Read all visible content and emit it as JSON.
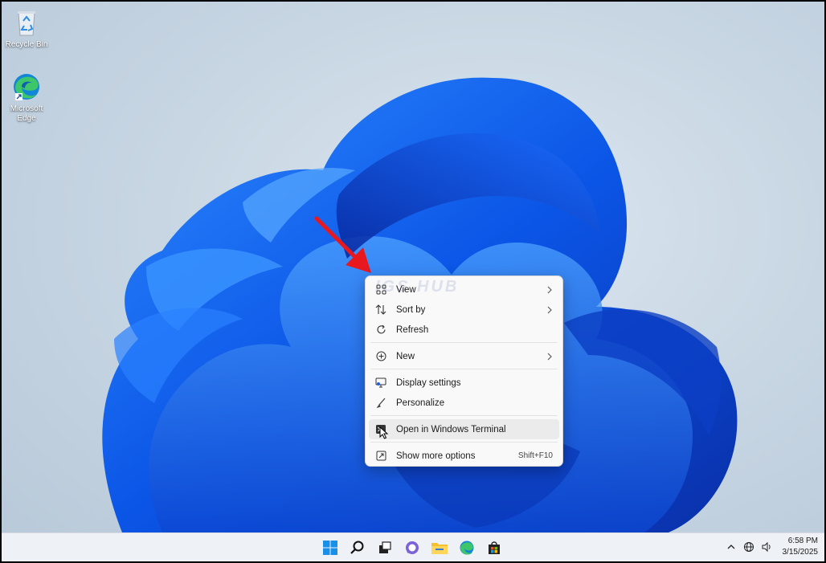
{
  "desktop": {
    "icons": [
      {
        "label": "Recycle Bin",
        "icon": "recycle-bin-icon"
      },
      {
        "label": "Microsoft Edge",
        "icon": "edge-icon"
      }
    ],
    "watermark": "IGS HUB"
  },
  "context_menu": {
    "items": [
      {
        "label": "View",
        "icon": "grid-view-icon",
        "submenu": true
      },
      {
        "label": "Sort by",
        "icon": "sort-icon",
        "submenu": true
      },
      {
        "label": "Refresh",
        "icon": "refresh-icon"
      },
      {
        "label": "New",
        "icon": "new-plus-icon",
        "submenu": true
      },
      {
        "label": "Display settings",
        "icon": "display-settings-icon"
      },
      {
        "label": "Personalize",
        "icon": "personalize-brush-icon"
      },
      {
        "label": "Open in Windows Terminal",
        "icon": "terminal-icon",
        "highlighted": true
      },
      {
        "label": "Show more options",
        "icon": "more-options-icon",
        "shortcut": "Shift+F10"
      }
    ]
  },
  "taskbar": {
    "apps": [
      "start-icon",
      "search-icon",
      "task-view-icon",
      "chat-icon",
      "file-explorer-icon",
      "edge-icon",
      "store-icon"
    ],
    "tray": [
      "chevron-up-icon",
      "network-globe-icon",
      "volume-icon"
    ],
    "time": "6:58 PM",
    "date": "3/15/2025"
  },
  "colors": {
    "accent": "#1f5fe0",
    "arrow": "#e8181f",
    "taskbar": "#eef1f5"
  }
}
